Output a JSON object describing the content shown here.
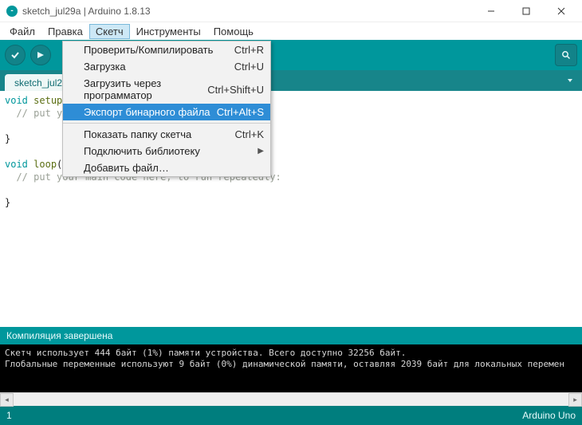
{
  "window": {
    "title": "sketch_jul29a | Arduino 1.8.13"
  },
  "menubar": {
    "items": [
      "Файл",
      "Правка",
      "Скетч",
      "Инструменты",
      "Помощь"
    ],
    "active_index": 2
  },
  "sketch_menu": {
    "items": [
      {
        "label": "Проверить/Компилировать",
        "shortcut": "Ctrl+R"
      },
      {
        "label": "Загрузка",
        "shortcut": "Ctrl+U"
      },
      {
        "label": "Загрузить через программатор",
        "shortcut": "Ctrl+Shift+U"
      },
      {
        "label": "Экспорт бинарного файла",
        "shortcut": "Ctrl+Alt+S",
        "highlight": true
      },
      {
        "sep": true
      },
      {
        "label": "Показать папку скетча",
        "shortcut": "Ctrl+K"
      },
      {
        "label": "Подключить библиотеку",
        "submenu": true
      },
      {
        "label": "Добавить файл…"
      }
    ]
  },
  "tab": {
    "name": "sketch_jul29"
  },
  "code": {
    "l1a": "void",
    "l1b": "setup",
    "l1c": "() {",
    "l2": "  // put yo",
    "l3": "}",
    "l4a": "void",
    "l4b": "loop",
    "l4c": "() {",
    "l5": "  // put your main code here, to run repeatedly:",
    "l6": "}"
  },
  "status": {
    "text": "Компиляция завершена"
  },
  "console": {
    "line1": "Скетч использует 444 байт (1%) памяти устройства. Всего доступно 32256 байт.",
    "line2": "Глобальные переменные используют 9 байт (0%) динамической памяти, оставляя 2039 байт для локальных перемен"
  },
  "footer": {
    "left": "1",
    "right": "Arduino Uno"
  }
}
